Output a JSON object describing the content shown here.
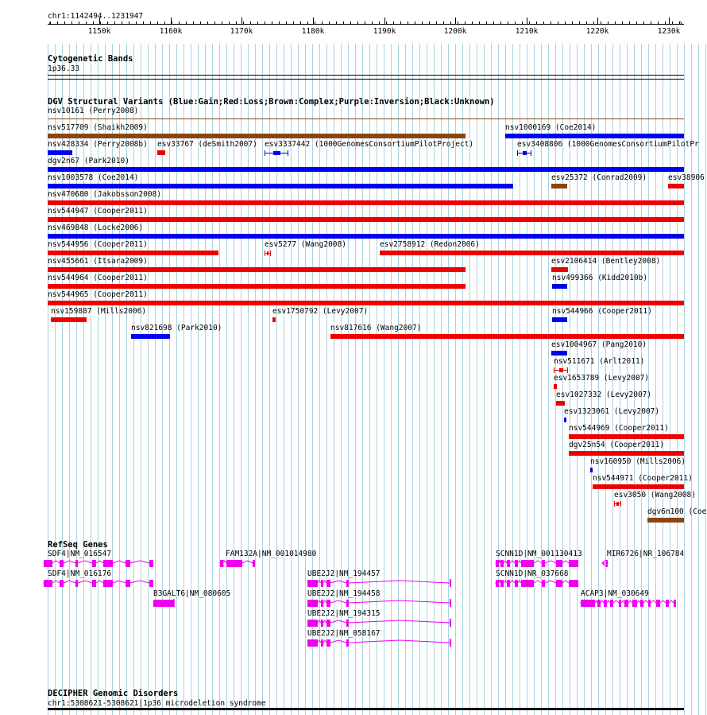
{
  "ruler": {
    "coordinates": "chr1:1142494..1231947",
    "ticks": [
      "1150k",
      "1160k",
      "1170k",
      "1180k",
      "1190k",
      "1200k",
      "1210k",
      "1220k",
      "1230k"
    ]
  },
  "colors": {
    "gain": "#0000ee",
    "loss": "#ee0000",
    "complex": "#8b4513",
    "gene": "#ee00ee",
    "grid": "#a8d4e0"
  },
  "tracks": {
    "cytoband": {
      "title": "Cytogenetic Bands",
      "band": "1p36.33"
    },
    "dgv": {
      "title": "DGV Structural Variants (Blue:Gain;Red:Loss;Brown:Complex;Purple:Inversion;Black:Unknown)",
      "variants": [
        {
          "label": "nsv10161 (Perry2008)",
          "type": "complex"
        },
        {
          "label": "nsv517709 (Shaikh2009)",
          "type": "complex"
        },
        {
          "label": "nsv1000169 (Coe2014)",
          "type": "gain"
        },
        {
          "label": "nsv428334 (Perry2008b)",
          "type": "gain"
        },
        {
          "label": "esv33767 (deSmith2007)",
          "type": "loss"
        },
        {
          "label": "esv3337442 (1000GenomesConsortiumPilotProject)",
          "type": "gain"
        },
        {
          "label": "esv3408806 (1000GenomesConsortiumPilotPr",
          "type": "gain"
        },
        {
          "label": "dgv2n67 (Park2010)",
          "type": "gain"
        },
        {
          "label": "nsv1003578 (Coe2014)",
          "type": "gain"
        },
        {
          "label": "esv25372 (Conrad2009)",
          "type": "complex"
        },
        {
          "label": "esv38906",
          "type": "loss"
        },
        {
          "label": "nsv470680 (Jakobsson2008)",
          "type": "loss"
        },
        {
          "label": "nsv544947 (Cooper2011)",
          "type": "loss"
        },
        {
          "label": "nsv469848 (Locke2006)",
          "type": "gain"
        },
        {
          "label": "nsv544956 (Cooper2011)",
          "type": "loss"
        },
        {
          "label": "esv5277 (Wang2008)",
          "type": "loss"
        },
        {
          "label": "esv2758912 (Redon2006)",
          "type": "loss"
        },
        {
          "label": "nsv455661 (Itsara2009)",
          "type": "loss"
        },
        {
          "label": "esv2106414 (Bentley2008)",
          "type": "loss"
        },
        {
          "label": "nsv544964 (Cooper2011)",
          "type": "loss"
        },
        {
          "label": "nsv499366 (Kidd2010b)",
          "type": "gain"
        },
        {
          "label": "nsv544965 (Cooper2011)",
          "type": "loss"
        },
        {
          "label": "nsv159887 (Mills2006)",
          "type": "loss"
        },
        {
          "label": "esv1750792 (Levy2007)",
          "type": "loss"
        },
        {
          "label": "nsv544966 (Cooper2011)",
          "type": "gain"
        },
        {
          "label": "nsv821698 (Park2010)",
          "type": "gain"
        },
        {
          "label": "nsv817616 (Wang2007)",
          "type": "loss"
        },
        {
          "label": "esv1004967 (Pang2010)",
          "type": "gain"
        },
        {
          "label": "nsv511671 (Arlt2011)",
          "type": "loss"
        },
        {
          "label": "esv1653789 (Levy2007)",
          "type": "loss"
        },
        {
          "label": "esv1027332 (Levy2007)",
          "type": "loss"
        },
        {
          "label": "esv1323061 (Levy2007)",
          "type": "gain"
        },
        {
          "label": "nsv544969 (Cooper2011)",
          "type": "loss"
        },
        {
          "label": "dgv25n54 (Cooper2011)",
          "type": "loss"
        },
        {
          "label": "nsv160950 (Mills2006)",
          "type": "gain"
        },
        {
          "label": "nsv544971 (Cooper2011)",
          "type": "loss"
        },
        {
          "label": "esv3050 (Wang2008)",
          "type": "loss"
        },
        {
          "label": "dgv6n100 (Coe",
          "type": "complex"
        }
      ]
    },
    "refseq": {
      "title": "RefSeq Genes",
      "genes": [
        {
          "label": "SDF4|NM_016547"
        },
        {
          "label": "FAM132A|NM_001014980"
        },
        {
          "label": "SCNN1D|NM_001130413"
        },
        {
          "label": "MIR6726|NR_106784"
        },
        {
          "label": "SDF4|NM_016176"
        },
        {
          "label": "UBE2J2|NM_194457"
        },
        {
          "label": "SCNN1D|NR_037668"
        },
        {
          "label": "B3GALT6|NM_080605"
        },
        {
          "label": "UBE2J2|NM_194458"
        },
        {
          "label": "ACAP3|NM_030649"
        },
        {
          "label": "UBE2J2|NM_194315"
        },
        {
          "label": "UBE2J2|NM_058167"
        }
      ]
    },
    "decipher": {
      "title": "DECIPHER Genomic Disorders",
      "entry": "chr1:5308621-5308621|1p36 microdeletion syndrome"
    }
  }
}
